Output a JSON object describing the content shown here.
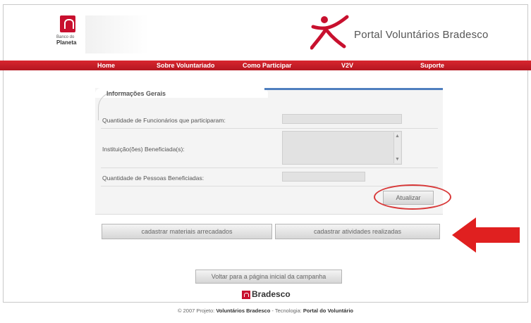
{
  "header": {
    "logo_text_small": "Banco do",
    "logo_text_big": "Planeta",
    "portal_title": "Portal Voluntários Bradesco"
  },
  "nav": {
    "items": [
      {
        "label": "Home"
      },
      {
        "label": "Sobre Voluntariado"
      },
      {
        "label": "Como Participar"
      },
      {
        "label": "V2V"
      },
      {
        "label": "Suporte"
      }
    ]
  },
  "panel": {
    "title": "Informações Gerais",
    "fields": [
      {
        "label": "Quantidade de Funcionários que participaram:",
        "value": ""
      },
      {
        "label": "Instituição(ões) Beneficiada(s):",
        "value": ""
      },
      {
        "label": "Quantidade de Pessoas Beneficiadas:",
        "value": ""
      }
    ],
    "update_button": "Atualizar"
  },
  "actions": {
    "materials_button": "cadastrar materiais arrecadados",
    "activities_button": "cadastrar atividades realizadas",
    "back_button": "Voltar para a página inicial da campanha"
  },
  "footer": {
    "brand": "Bradesco",
    "prefix": "© 2007 Projeto:",
    "project": "Voluntários Bradesco",
    "middle": " - Tecnologia:",
    "tech": "Portal do Voluntário"
  },
  "colors": {
    "nav_red": "#c8102e",
    "annotation_red": "#d83838",
    "panel_accent": "#4f7fbf"
  },
  "icons": {
    "scroll_up": "▲",
    "scroll_down": "▼"
  }
}
